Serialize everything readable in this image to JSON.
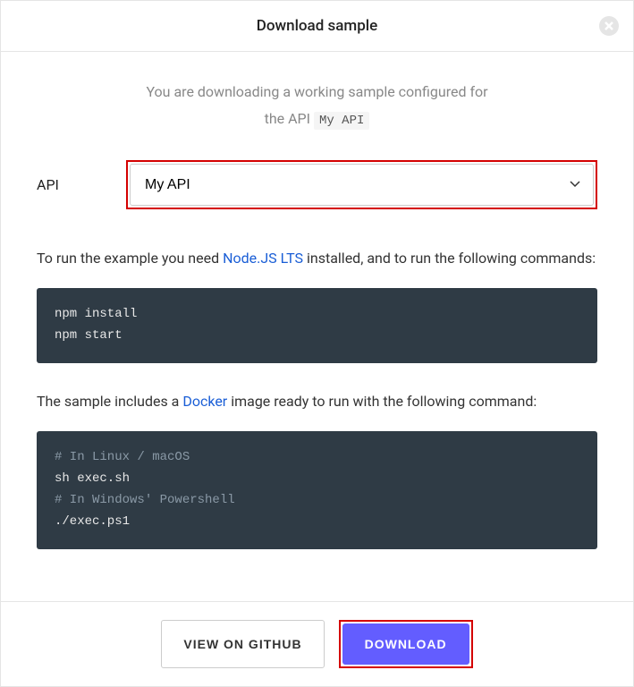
{
  "header": {
    "title": "Download sample"
  },
  "intro": {
    "line1": "You are downloading a working sample configured for",
    "line2_prefix": "the API",
    "api_name": "My API"
  },
  "api_section": {
    "label": "API",
    "selected": "My API"
  },
  "run_instructions": {
    "prefix": "To run the example you need ",
    "link_text": "Node.JS LTS",
    "suffix": " installed, and to run the following commands:"
  },
  "code_block_1": {
    "line1": "npm install",
    "line2": "npm start"
  },
  "docker_instructions": {
    "prefix": "The sample includes a ",
    "link_text": "Docker",
    "suffix": " image ready to run with the following command:"
  },
  "code_block_2": {
    "comment1": "# In Linux / macOS",
    "cmd1": "sh exec.sh",
    "comment2": "# In Windows' Powershell",
    "cmd2": "./exec.ps1"
  },
  "footer": {
    "view_github": "VIEW ON GITHUB",
    "download": "DOWNLOAD"
  }
}
